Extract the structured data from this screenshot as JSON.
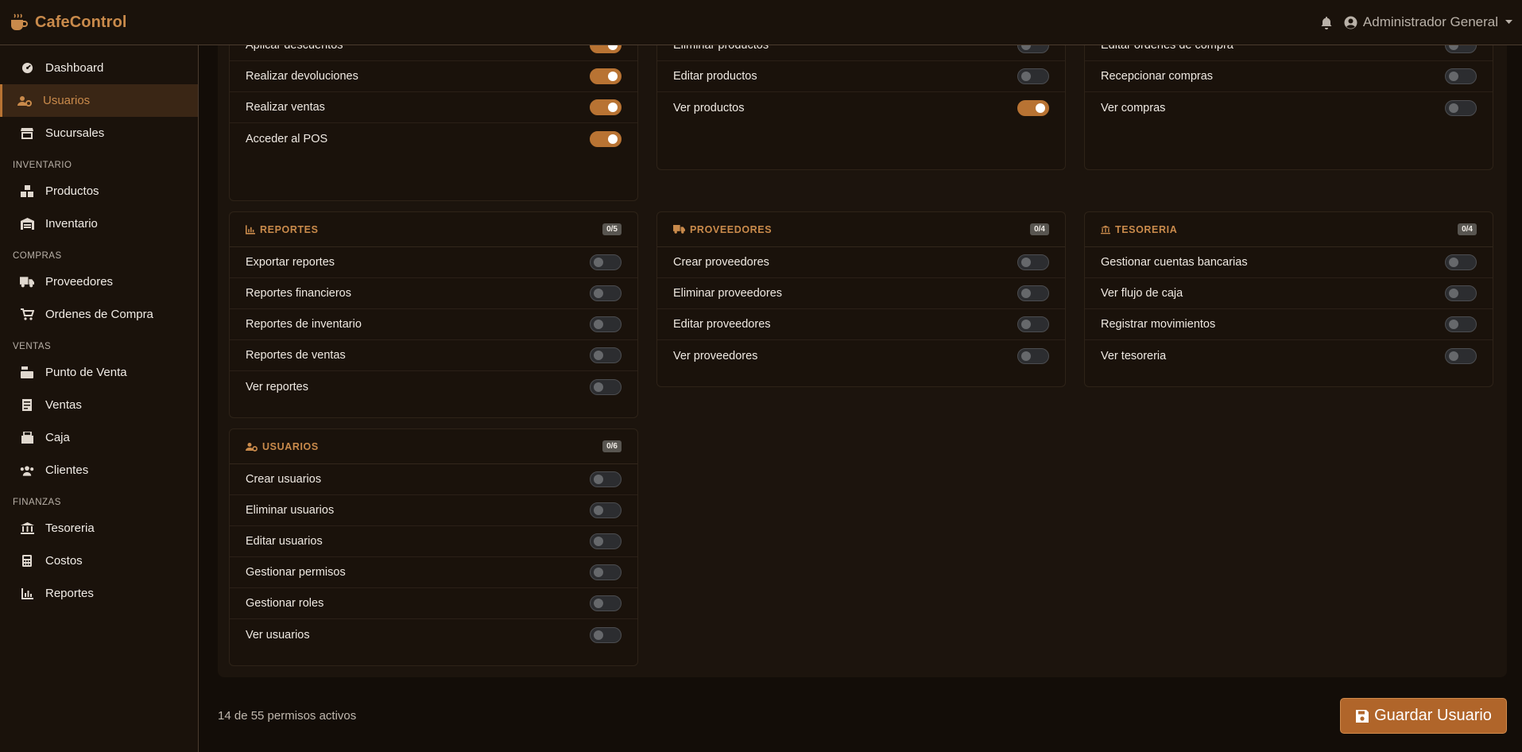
{
  "app": {
    "name": "CafeControl"
  },
  "header": {
    "user_name": "Administrador General"
  },
  "sidebar": {
    "items": [
      {
        "label": "Dashboard",
        "icon": "gauge-icon"
      },
      {
        "label": "Usuarios",
        "icon": "users-cog-icon",
        "active": true
      },
      {
        "label": "Sucursales",
        "icon": "store-icon"
      }
    ],
    "sections": [
      {
        "title": "INVENTARIO",
        "items": [
          {
            "label": "Productos",
            "icon": "boxes-icon"
          },
          {
            "label": "Inventario",
            "icon": "warehouse-icon"
          }
        ]
      },
      {
        "title": "COMPRAS",
        "items": [
          {
            "label": "Proveedores",
            "icon": "truck-icon"
          },
          {
            "label": "Ordenes de Compra",
            "icon": "cart-icon"
          }
        ]
      },
      {
        "title": "VENTAS",
        "items": [
          {
            "label": "Punto de Venta",
            "icon": "cash-register-icon"
          },
          {
            "label": "Ventas",
            "icon": "receipt-icon"
          },
          {
            "label": "Caja",
            "icon": "cash-box-icon"
          },
          {
            "label": "Clientes",
            "icon": "users-icon"
          }
        ]
      },
      {
        "title": "FINANZAS",
        "items": [
          {
            "label": "Tesoreria",
            "icon": "bank-icon"
          },
          {
            "label": "Costos",
            "icon": "calculator-icon"
          },
          {
            "label": "Reportes",
            "icon": "chart-icon"
          }
        ]
      }
    ]
  },
  "cards": {
    "ventas": {
      "permissions": [
        {
          "label": "Aplicar descuentos",
          "on": true
        },
        {
          "label": "Realizar devoluciones",
          "on": true
        },
        {
          "label": "Realizar ventas",
          "on": true
        },
        {
          "label": "Acceder al POS",
          "on": true
        }
      ]
    },
    "productos": {
      "permissions": [
        {
          "label": "Eliminar productos",
          "on": false
        },
        {
          "label": "Editar productos",
          "on": false
        },
        {
          "label": "Ver productos",
          "on": true
        }
      ]
    },
    "compras": {
      "permissions": [
        {
          "label": "Editar ordenes de compra",
          "on": false
        },
        {
          "label": "Recepcionar compras",
          "on": false
        },
        {
          "label": "Ver compras",
          "on": false
        }
      ]
    },
    "reportes": {
      "title": "REPORTES",
      "badge": "0/5",
      "icon": "chart-icon",
      "permissions": [
        {
          "label": "Exportar reportes",
          "on": false
        },
        {
          "label": "Reportes financieros",
          "on": false
        },
        {
          "label": "Reportes de inventario",
          "on": false
        },
        {
          "label": "Reportes de ventas",
          "on": false
        },
        {
          "label": "Ver reportes",
          "on": false
        }
      ]
    },
    "proveedores": {
      "title": "PROVEEDORES",
      "badge": "0/4",
      "icon": "truck-icon",
      "permissions": [
        {
          "label": "Crear proveedores",
          "on": false
        },
        {
          "label": "Eliminar proveedores",
          "on": false
        },
        {
          "label": "Editar proveedores",
          "on": false
        },
        {
          "label": "Ver proveedores",
          "on": false
        }
      ]
    },
    "tesoreria": {
      "title": "TESORERIA",
      "badge": "0/4",
      "icon": "bank-icon",
      "permissions": [
        {
          "label": "Gestionar cuentas bancarias",
          "on": false
        },
        {
          "label": "Ver flujo de caja",
          "on": false
        },
        {
          "label": "Registrar movimientos",
          "on": false
        },
        {
          "label": "Ver tesoreria",
          "on": false
        }
      ]
    },
    "usuarios": {
      "title": "USUARIOS",
      "badge": "0/6",
      "icon": "users-cog-icon",
      "permissions": [
        {
          "label": "Crear usuarios",
          "on": false
        },
        {
          "label": "Eliminar usuarios",
          "on": false
        },
        {
          "label": "Editar usuarios",
          "on": false
        },
        {
          "label": "Gestionar permisos",
          "on": false
        },
        {
          "label": "Gestionar roles",
          "on": false
        },
        {
          "label": "Ver usuarios",
          "on": false
        }
      ]
    }
  },
  "footer": {
    "summary": "14 de 55 permisos activos",
    "save_label": "Guardar Usuario"
  },
  "colors": {
    "accent": "#c98a4b",
    "toggle_on": "#b87333",
    "button": "#b0652a",
    "background": "#130d08"
  }
}
